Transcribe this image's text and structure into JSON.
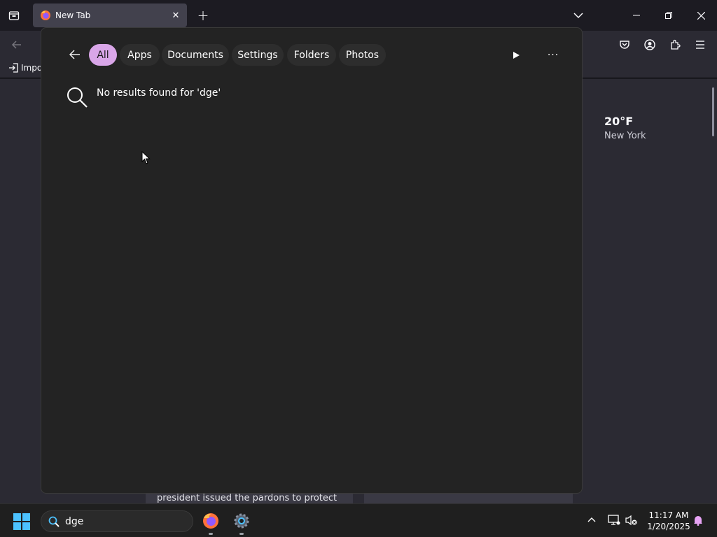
{
  "browser": {
    "tab_title": "New Tab",
    "new_tab_symbol": "+",
    "close_tab_symbol": "✕",
    "bookmark_import_label": "Impo"
  },
  "page": {
    "weather_temp": "20°F",
    "weather_city": "New York",
    "news_snippet": "president issued the pardons to protect"
  },
  "search_flyout": {
    "filters": [
      {
        "label": "All",
        "active": true
      },
      {
        "label": "Apps",
        "active": false
      },
      {
        "label": "Documents",
        "active": false
      },
      {
        "label": "Settings",
        "active": false
      },
      {
        "label": "Folders",
        "active": false
      },
      {
        "label": "Photos",
        "active": false
      }
    ],
    "no_results_text": "No results found for 'dge'",
    "more_symbol": "···"
  },
  "taskbar": {
    "search_value": "dge",
    "apps": [
      "firefox-icon",
      "settings-icon"
    ],
    "clock_time": "11:17 AM",
    "clock_date": "1/20/2025"
  },
  "colors": {
    "active_chip": "#d9a6e8",
    "flyout_bg": "#232323",
    "taskbar_bg": "#1f1f1f",
    "browser_bg": "#2b2a33"
  }
}
